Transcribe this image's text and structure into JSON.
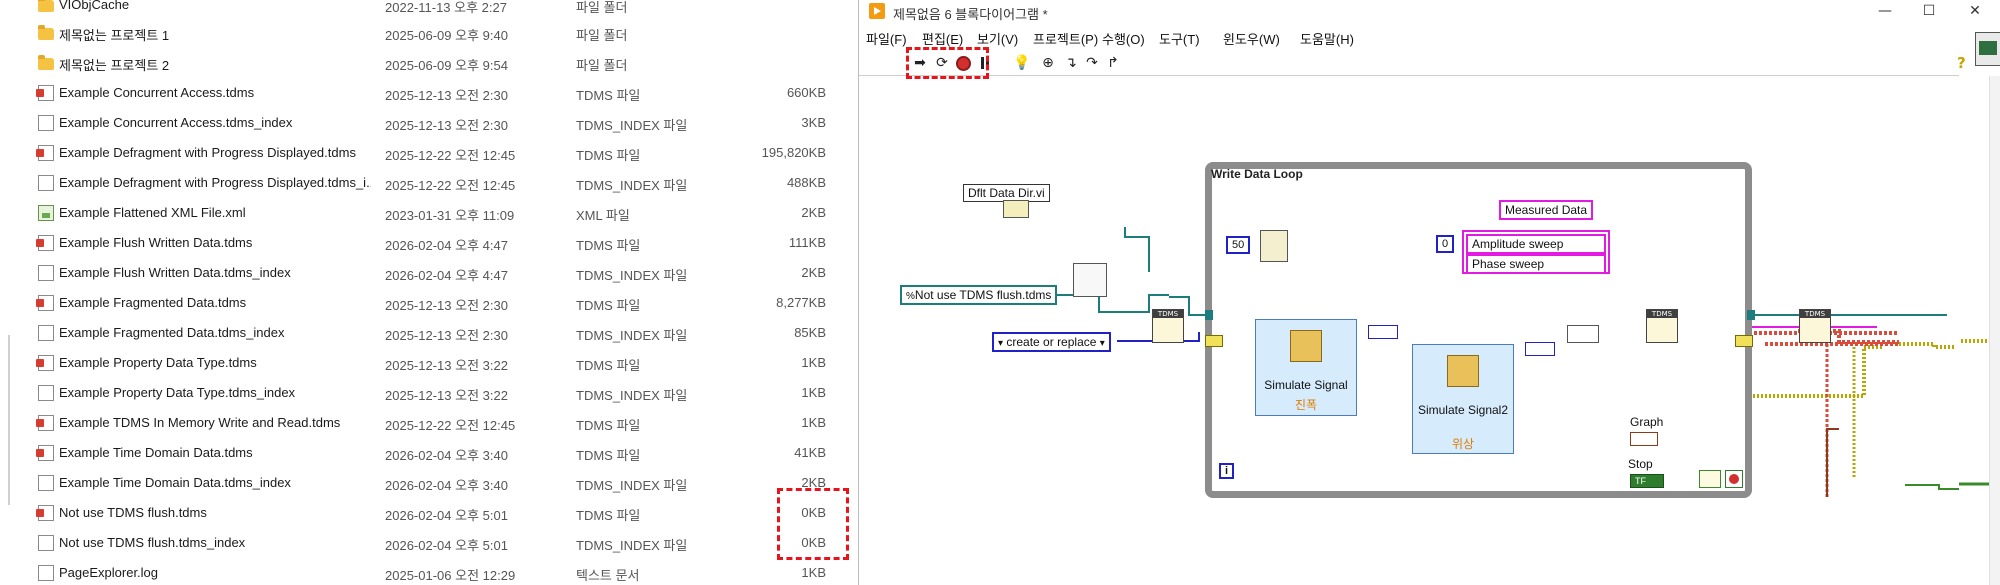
{
  "explorer": {
    "rows": [
      {
        "name": "VIObjCache",
        "date": "2022-11-13 오후 2:27",
        "type": "파일 폴더",
        "size": "",
        "icon": "folder-icon"
      },
      {
        "name": "제목없는 프로젝트 1",
        "date": "2025-06-09 오후 9:40",
        "type": "파일 폴더",
        "size": "",
        "icon": "folder-icon"
      },
      {
        "name": "제목없는 프로젝트 2",
        "date": "2025-06-09 오후 9:54",
        "type": "파일 폴더",
        "size": "",
        "icon": "folder-icon"
      },
      {
        "name": "Example Concurrent Access.tdms",
        "date": "2025-12-13 오전 2:30",
        "type": "TDMS 파일",
        "size": "660KB",
        "icon": "tdms-file-icon"
      },
      {
        "name": "Example Concurrent Access.tdms_index",
        "date": "2025-12-13 오전 2:30",
        "type": "TDMS_INDEX 파일",
        "size": "3KB",
        "icon": "document-icon"
      },
      {
        "name": "Example Defragment with Progress Displayed.tdms",
        "date": "2025-12-22 오전 12:45",
        "type": "TDMS 파일",
        "size": "195,820KB",
        "icon": "tdms-file-icon"
      },
      {
        "name": "Example Defragment with Progress Displayed.tdms_i...",
        "date": "2025-12-22 오전 12:45",
        "type": "TDMS_INDEX 파일",
        "size": "488KB",
        "icon": "document-icon"
      },
      {
        "name": "Example Flattened XML File.xml",
        "date": "2023-01-31 오후 11:09",
        "type": "XML 파일",
        "size": "2KB",
        "icon": "xml-file-icon"
      },
      {
        "name": "Example Flush Written Data.tdms",
        "date": "2026-02-04 오후 4:47",
        "type": "TDMS 파일",
        "size": "111KB",
        "icon": "tdms-file-icon"
      },
      {
        "name": "Example Flush Written Data.tdms_index",
        "date": "2026-02-04 오후 4:47",
        "type": "TDMS_INDEX 파일",
        "size": "2KB",
        "icon": "document-icon"
      },
      {
        "name": "Example Fragmented Data.tdms",
        "date": "2025-12-13 오전 2:30",
        "type": "TDMS 파일",
        "size": "8,277KB",
        "icon": "tdms-file-icon"
      },
      {
        "name": "Example Fragmented Data.tdms_index",
        "date": "2025-12-13 오전 2:30",
        "type": "TDMS_INDEX 파일",
        "size": "85KB",
        "icon": "document-icon"
      },
      {
        "name": "Example Property Data Type.tdms",
        "date": "2025-12-13 오전 3:22",
        "type": "TDMS 파일",
        "size": "1KB",
        "icon": "tdms-file-icon"
      },
      {
        "name": "Example Property Data Type.tdms_index",
        "date": "2025-12-13 오전 3:22",
        "type": "TDMS_INDEX 파일",
        "size": "1KB",
        "icon": "document-icon"
      },
      {
        "name": "Example TDMS In Memory Write and Read.tdms",
        "date": "2025-12-22 오전 12:45",
        "type": "TDMS 파일",
        "size": "1KB",
        "icon": "tdms-file-icon"
      },
      {
        "name": "Example Time Domain Data.tdms",
        "date": "2026-02-04 오후 3:40",
        "type": "TDMS 파일",
        "size": "41KB",
        "icon": "tdms-file-icon"
      },
      {
        "name": "Example Time Domain Data.tdms_index",
        "date": "2026-02-04 오후 3:40",
        "type": "TDMS_INDEX 파일",
        "size": "2KB",
        "icon": "document-icon"
      },
      {
        "name": "Not use TDMS flush.tdms",
        "date": "2026-02-04 오후 5:01",
        "type": "TDMS 파일",
        "size": "0KB",
        "icon": "tdms-file-icon"
      },
      {
        "name": "Not use TDMS flush.tdms_index",
        "date": "2026-02-04 오후 5:01",
        "type": "TDMS_INDEX 파일",
        "size": "0KB",
        "icon": "document-icon"
      },
      {
        "name": "PageExplorer.log",
        "date": "2025-01-06 오전 12:29",
        "type": "텍스트 문서",
        "size": "1KB",
        "icon": "document-icon"
      }
    ]
  },
  "labview": {
    "title": "제목없음 6 블록다이어그램 *",
    "window_buttons": {
      "minimize": "—",
      "maximize": "☐",
      "close": "✕"
    },
    "menu": [
      "파일(F)",
      "편집(E)",
      "보기(V)",
      "프로젝트(P)",
      "수행(O)",
      "도구(T)",
      "윈도우(W)",
      "도움말(H)"
    ],
    "toolbar": {
      "run": "➡",
      "run_continuously": "⟳",
      "abort": "abort",
      "pause": "pause",
      "highlight": "💡",
      "retain": "⊕",
      "step_into": "↴",
      "step_over": "↷",
      "step_out": "↱",
      "help": "?"
    },
    "diagram": {
      "loop_title": "Write Data Loop",
      "dflt_data_dir": "Dflt Data Dir.vi",
      "file_path": "Not use TDMS flush.tdms",
      "operation": "create or replace",
      "wait_ms": "50",
      "measured_data": "Measured Data",
      "zero_const": "0",
      "amplitude_sweep": "Amplitude sweep",
      "phase_sweep": "Phase sweep",
      "simulate_signal_1": "Simulate Signal",
      "simulate_signal_1_sub": "진폭",
      "simulate_signal_2": "Simulate Signal2",
      "simulate_signal_2_sub": "위상",
      "graph_label": "Graph",
      "stop_label": "Stop",
      "stop_value": "TF",
      "iteration": "i",
      "tdms_tag": "TDMS"
    }
  }
}
